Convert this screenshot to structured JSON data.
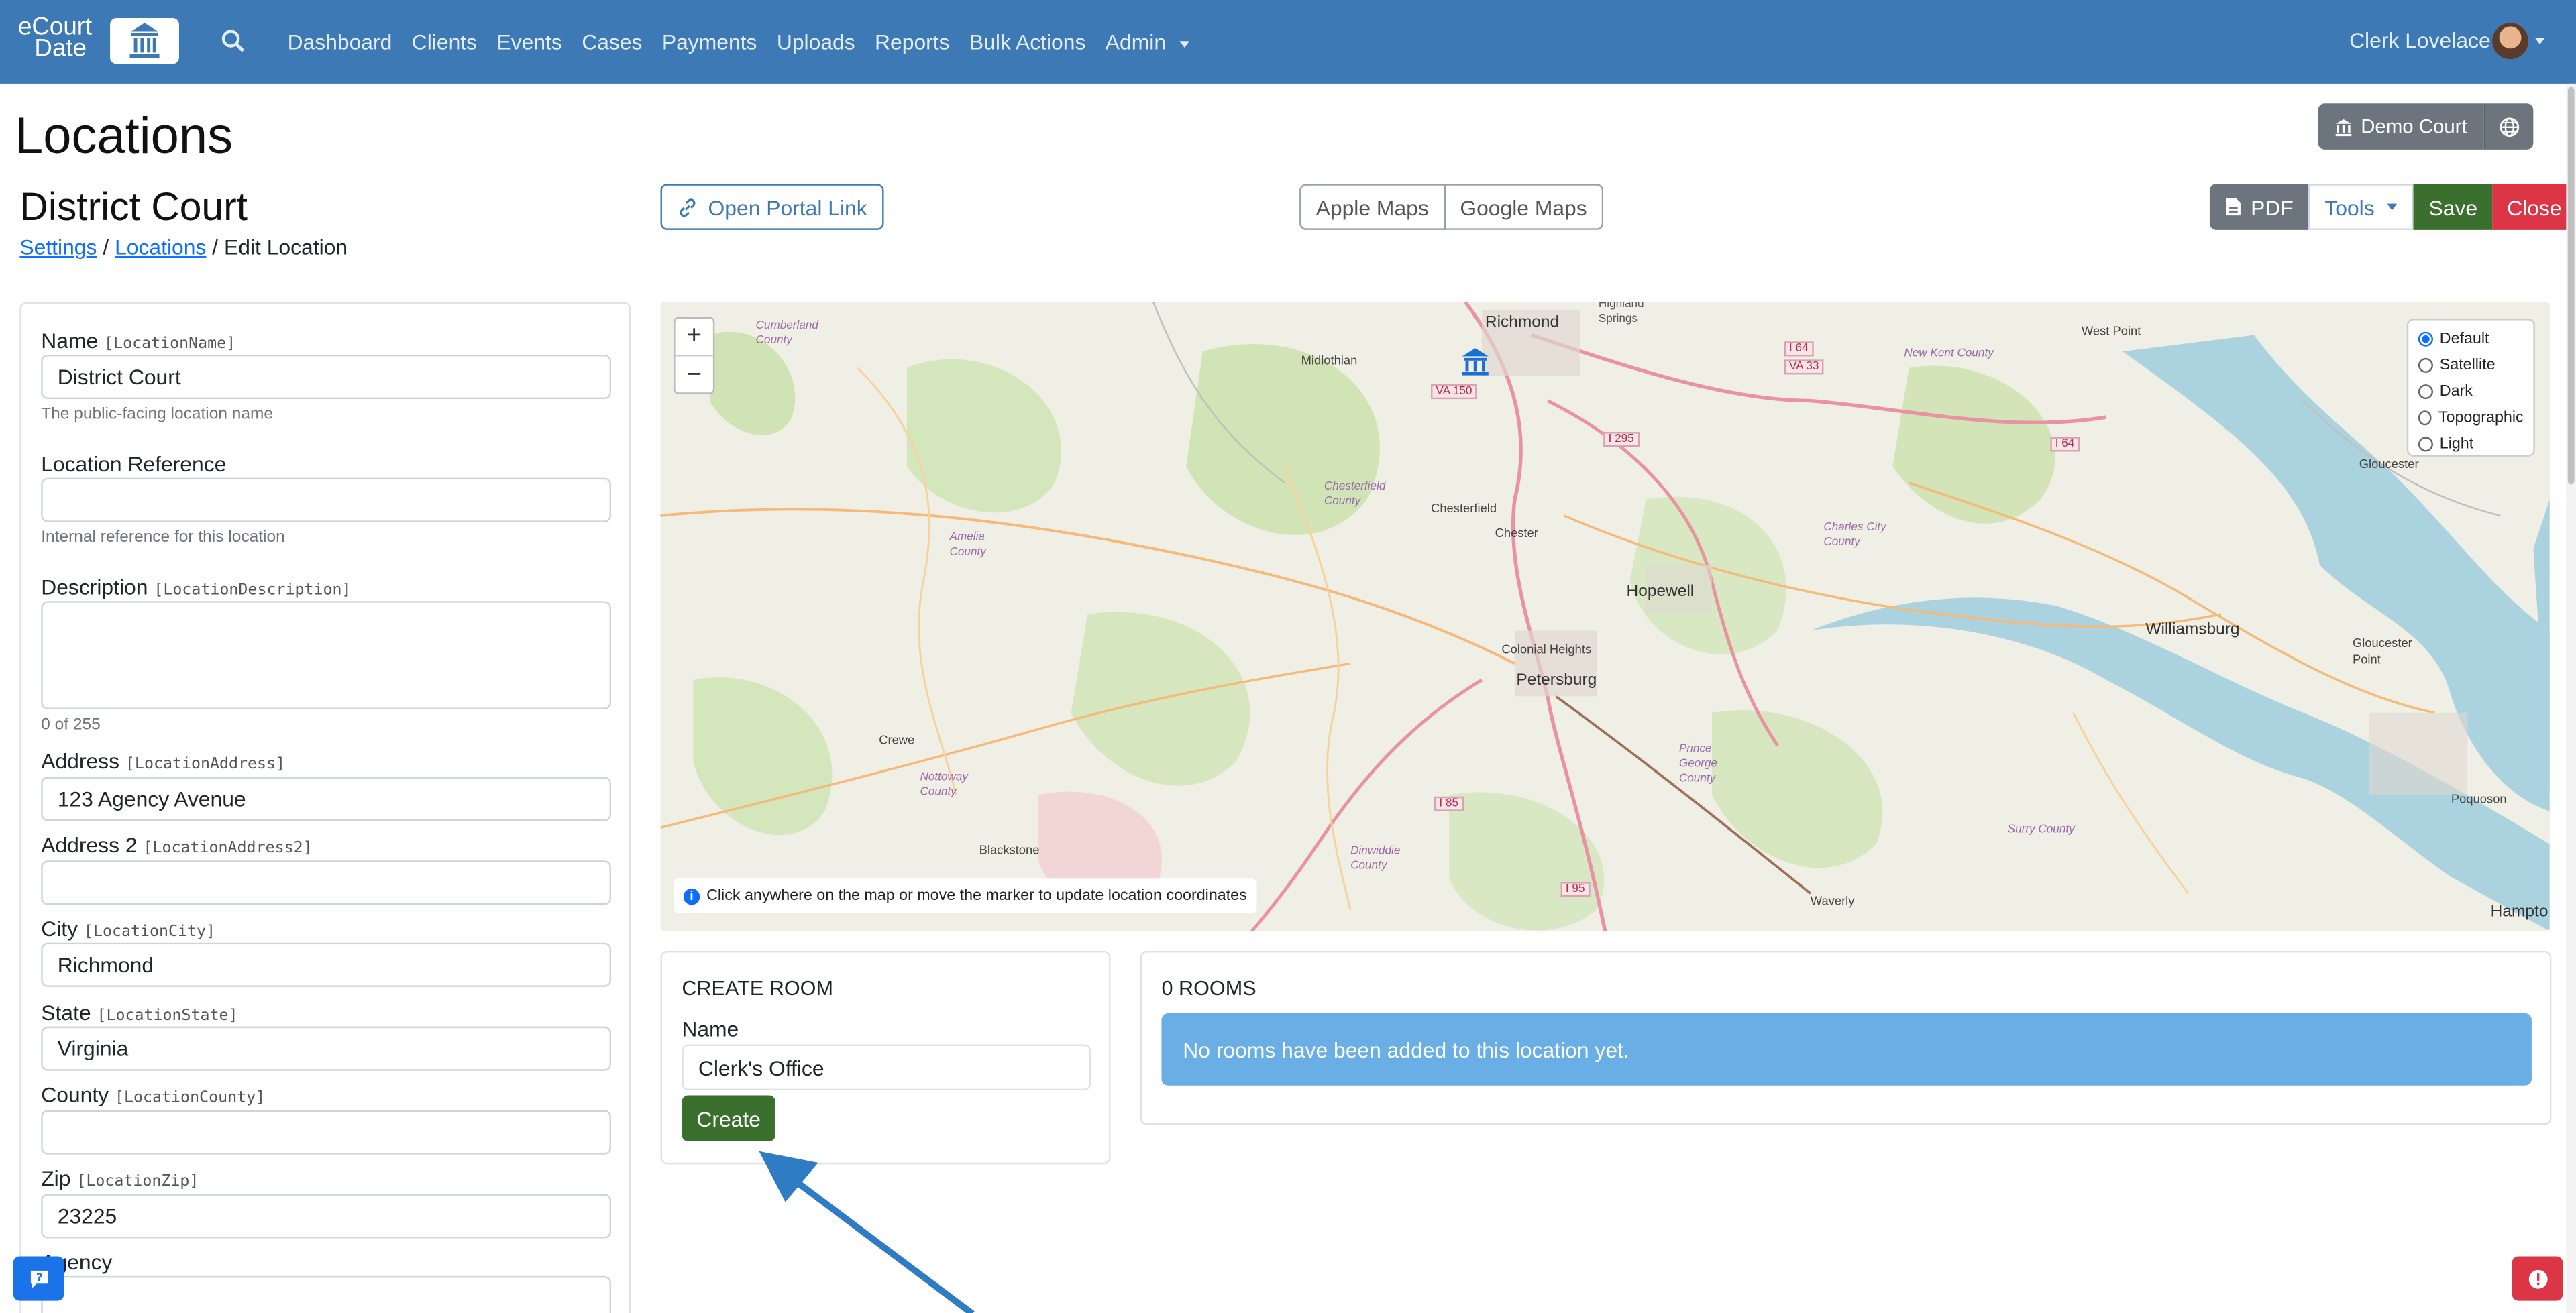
{
  "nav": {
    "logo_line1": "eCourt",
    "logo_line2": "Date",
    "links": [
      "Dashboard",
      "Clients",
      "Events",
      "Cases",
      "Payments",
      "Uploads",
      "Reports",
      "Bulk Actions",
      "Admin"
    ],
    "user": "Clerk Lovelace"
  },
  "page": {
    "title": "Locations",
    "court_button": "Demo Court",
    "location_name": "District Court",
    "breadcrumb": {
      "settings": "Settings",
      "locations": "Locations",
      "current": "Edit Location",
      "sep": "/"
    },
    "portal_link": "Open Portal Link",
    "maps": [
      "Apple Maps",
      "Google Maps"
    ],
    "toolbar": {
      "pdf": "PDF",
      "tools": "Tools",
      "save": "Save",
      "close": "Close"
    }
  },
  "form": {
    "name": {
      "label": "Name",
      "key": "[LocationName]",
      "value": "District Court",
      "help": "The public-facing location name"
    },
    "reference": {
      "label": "Location Reference",
      "value": "",
      "help": "Internal reference for this location"
    },
    "description": {
      "label": "Description",
      "key": "[LocationDescription]",
      "value": "",
      "counter": "0 of 255"
    },
    "address": {
      "label": "Address",
      "key": "[LocationAddress]",
      "value": "123 Agency Avenue"
    },
    "address2": {
      "label": "Address 2",
      "key": "[LocationAddress2]",
      "value": ""
    },
    "city": {
      "label": "City",
      "key": "[LocationCity]",
      "value": "Richmond"
    },
    "state": {
      "label": "State",
      "key": "[LocationState]",
      "value": "Virginia"
    },
    "county": {
      "label": "County",
      "key": "[LocationCounty]",
      "value": ""
    },
    "zip": {
      "label": "Zip",
      "key": "[LocationZip]",
      "value": "23225"
    },
    "agency": {
      "label": "Agency"
    }
  },
  "map": {
    "layers": [
      "Default",
      "Satellite",
      "Dark",
      "Topographic",
      "Light"
    ],
    "selected_layer": "Default",
    "note": "Click anywhere on the map or move the marker to update location coordinates",
    "places": {
      "richmond": "Richmond",
      "midlothian": "Midlothian",
      "highland_springs": "Highland Springs",
      "new_kent": "New Kent County",
      "west_point": "West Point",
      "chesterfield": "Chesterfield",
      "chester": "Chester",
      "hopewell": "Hopewell",
      "colonial_heights": "Colonial Heights",
      "petersburg": "Petersburg",
      "williamsburg": "Williamsburg",
      "gloucester": "Gloucester",
      "gloucester_point": "Gloucester Point",
      "crewe": "Crewe",
      "blackstone": "Blackstone",
      "waverly": "Waverly",
      "poquoson": "Poquoson",
      "hampton": "Hampto",
      "amelia": "Amelia County",
      "charles_city": "Charles City County",
      "prince_george": "Prince George County",
      "dinwiddie": "Dinwiddie County",
      "surry": "Surry County",
      "nottoway": "Nottoway County",
      "chesterfield_county": "Chesterfield County",
      "cumberland": "Cumberland County"
    },
    "shields": [
      "VA 150",
      "I 295",
      "I 64",
      "VA 33",
      "I 64",
      "I 85",
      "I 95"
    ]
  },
  "rooms": {
    "create_title": "CREATE ROOM",
    "name_label": "Name",
    "name_value": "Clerk's Office",
    "create_button": "Create",
    "count_title": "0 ROOMS",
    "empty_message": "No rooms have been added to this location yet."
  },
  "colors": {
    "navbar": "#3d79b4",
    "save": "#3a6f2e",
    "close": "#dc3545",
    "alert": "#6aaee6"
  }
}
